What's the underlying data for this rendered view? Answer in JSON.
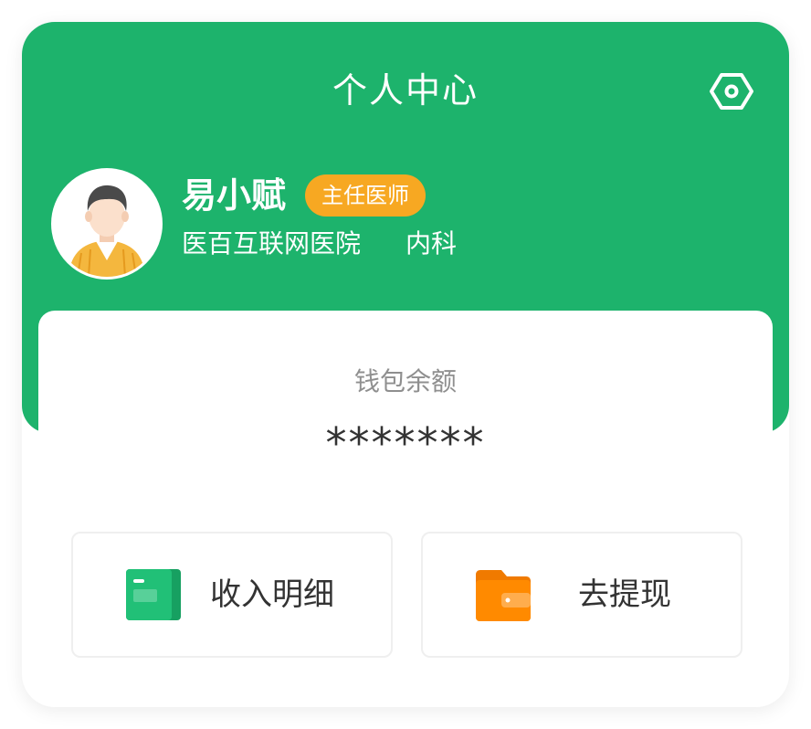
{
  "header": {
    "title": "个人中心",
    "settings_icon": "settings-icon",
    "background_color": "#1db36c"
  },
  "profile": {
    "name": "易小赋",
    "title_badge": "主任医师",
    "badge_color": "#f7a822",
    "hospital": "医百互联网医院",
    "department": "内科",
    "avatar_icon": "doctor-avatar"
  },
  "wallet": {
    "label": "钱包余额",
    "balance": "*******"
  },
  "actions": [
    {
      "label": "收入明细",
      "icon": "income-folder-icon",
      "color": "#1db36c"
    },
    {
      "label": "去提现",
      "icon": "wallet-icon",
      "color": "#ff8a00"
    }
  ]
}
